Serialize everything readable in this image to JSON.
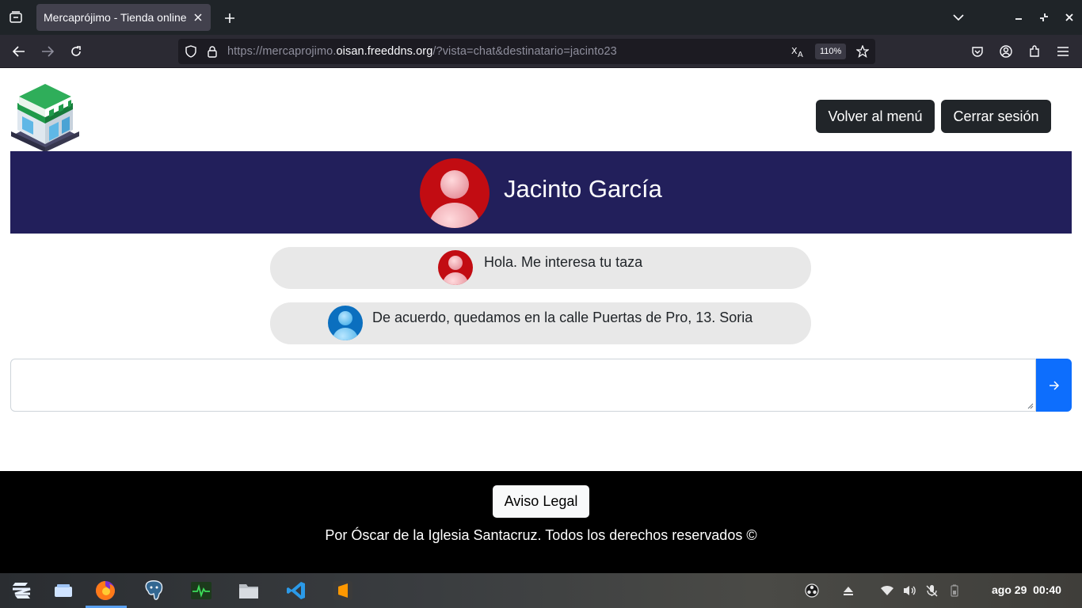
{
  "browser": {
    "tab_title": "Mercaprójimo - Tienda online",
    "url_prefix": "https://mercaprojimo.",
    "url_host": "oisan.freeddns.org",
    "url_path": "/?vista=chat&destinatario=jacinto23",
    "zoom": "110%"
  },
  "header": {
    "back_to_menu": "Volver al menú",
    "logout": "Cerrar sesión"
  },
  "chat": {
    "contact_name": "Jacinto García",
    "messages": [
      {
        "text": "Hola. Me interesa tu taza",
        "avatar": "red-user-avatar"
      },
      {
        "text": "De acuerdo, quedamos en la calle Puertas de Pro, 13. Soria",
        "avatar": "blue-user-avatar"
      }
    ],
    "input_value": ""
  },
  "footer": {
    "legal_button": "Aviso Legal",
    "copyright": "Por Óscar de la Iglesia Santacruz. Todos los derechos reservados ©"
  },
  "taskbar": {
    "date": "ago 29",
    "time": "00:40"
  },
  "colors": {
    "chat_header_bg": "#221f5b",
    "send_button": "#0d6efd",
    "dark_button": "#212529",
    "bubble_bg": "#e8e8e8"
  }
}
